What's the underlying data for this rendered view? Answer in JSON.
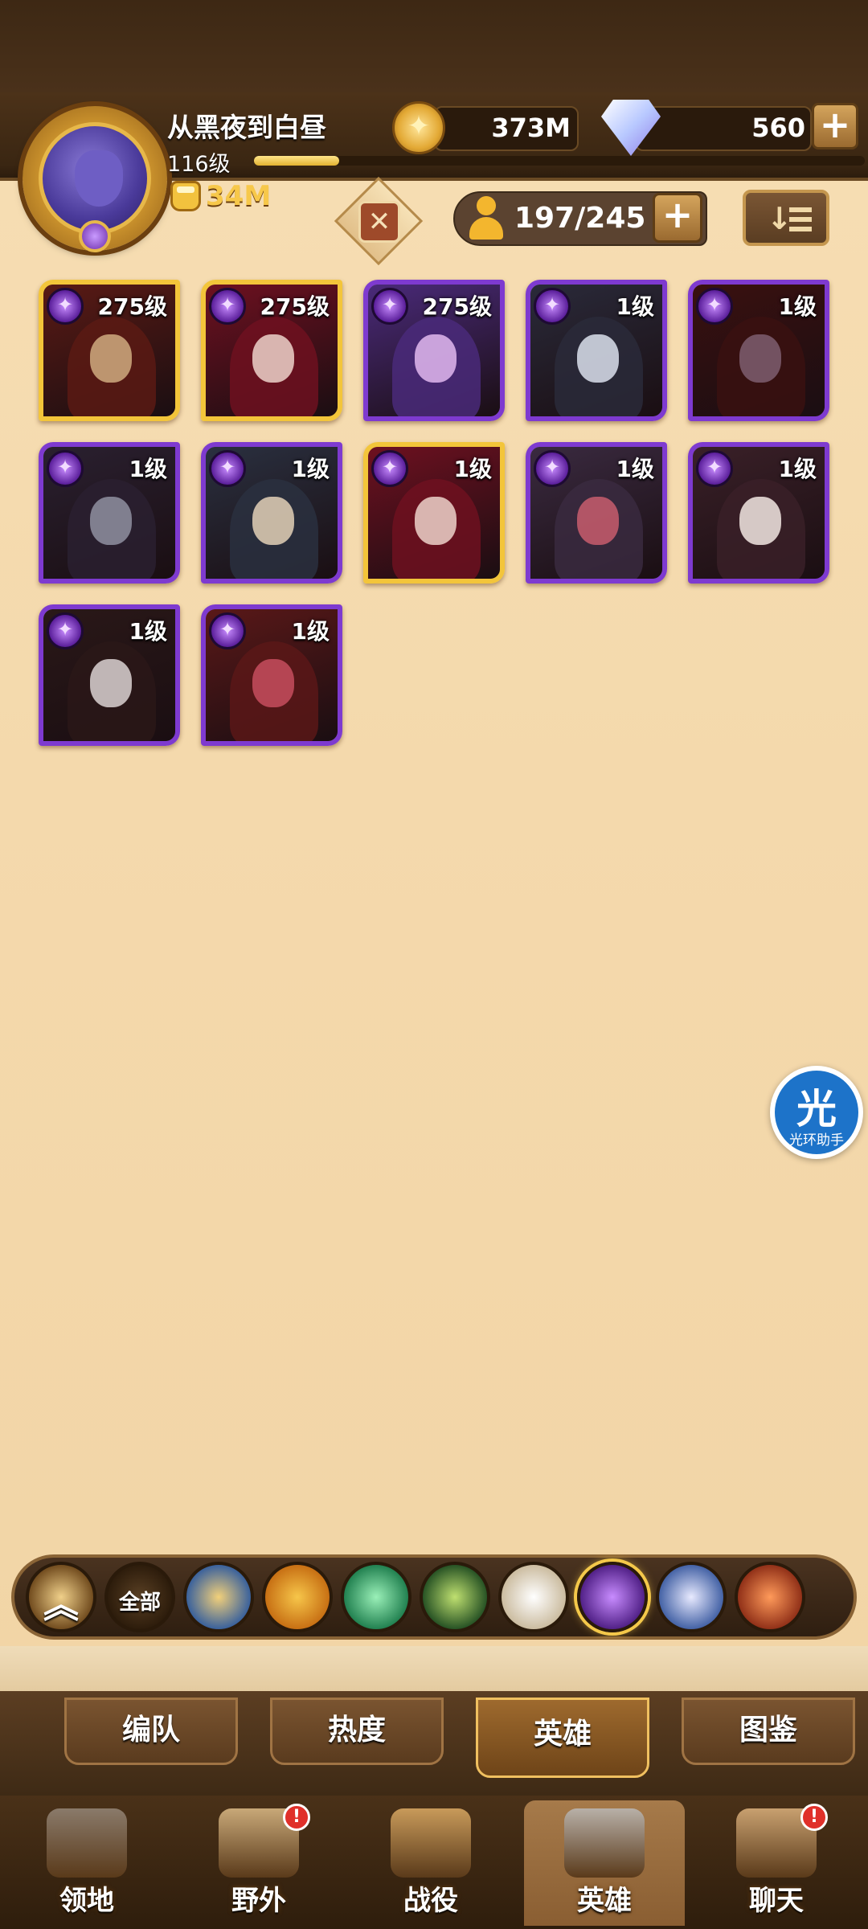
{
  "player": {
    "name": "从黑夜到白昼",
    "level": "116级",
    "power": "34M",
    "xp_progress": 0.14
  },
  "currency": {
    "gold": "373M",
    "gems": "560",
    "plus": "+"
  },
  "toolbar": {
    "hero_count": "197/245",
    "plus": "+"
  },
  "heroes": [
    {
      "level": "275级",
      "frame": "gold",
      "colors": [
        "#5a1a14",
        "#c9a37a"
      ]
    },
    {
      "level": "275级",
      "frame": "gold",
      "colors": [
        "#6e1020",
        "#e6c8c0"
      ]
    },
    {
      "level": "275级",
      "frame": "purple",
      "colors": [
        "#4a2a7a",
        "#d8b0e8"
      ]
    },
    {
      "level": "1级",
      "frame": "purple",
      "colors": [
        "#2a2a3a",
        "#d0d6e2"
      ]
    },
    {
      "level": "1级",
      "frame": "purple",
      "colors": [
        "#3a1010",
        "#7a5a6a"
      ]
    },
    {
      "level": "1级",
      "frame": "purple",
      "colors": [
        "#2a2030",
        "#8a8a9a"
      ]
    },
    {
      "level": "1级",
      "frame": "purple",
      "colors": [
        "#2a3040",
        "#d8c8b0"
      ]
    },
    {
      "level": "1级",
      "frame": "gold",
      "colors": [
        "#6e1020",
        "#e6c8c0"
      ]
    },
    {
      "level": "1级",
      "frame": "purple",
      "colors": [
        "#3a2a40",
        "#c05a6a"
      ]
    },
    {
      "level": "1级",
      "frame": "purple",
      "colors": [
        "#3a2028",
        "#e8dcd8"
      ]
    },
    {
      "level": "1级",
      "frame": "purple",
      "colors": [
        "#2a1818",
        "#d0c8c8"
      ]
    },
    {
      "level": "1级",
      "frame": "purple",
      "colors": [
        "#5a1818",
        "#c04a5a"
      ]
    }
  ],
  "faction_filters": [
    {
      "name": "up-chevron",
      "label": "",
      "colors": [
        "#f0d08a",
        "#6a4418"
      ]
    },
    {
      "name": "all",
      "label": "全部",
      "colors": [
        "#5a4024",
        "#2a1a0a"
      ]
    },
    {
      "name": "lightbearer",
      "label": "",
      "colors": [
        "#f2d07a",
        "#2e5a9e"
      ]
    },
    {
      "name": "mauler",
      "label": "",
      "colors": [
        "#f7c64a",
        "#c46a10"
      ]
    },
    {
      "name": "wilder",
      "label": "",
      "colors": [
        "#9af0b8",
        "#1a7a4a"
      ]
    },
    {
      "name": "graveborn",
      "label": "",
      "colors": [
        "#bfe070",
        "#1e4a20"
      ]
    },
    {
      "name": "celestial",
      "label": "",
      "colors": [
        "#ffffff",
        "#c8b89a"
      ]
    },
    {
      "name": "hypogean",
      "label": "",
      "colors": [
        "#c88cff",
        "#4a1a80"
      ]
    },
    {
      "name": "dimensional",
      "label": "",
      "colors": [
        "#e8eaff",
        "#3a5aa0"
      ]
    },
    {
      "name": "dragon",
      "label": "",
      "colors": [
        "#ff9a5a",
        "#8a2a14"
      ]
    }
  ],
  "selected_faction_index": 7,
  "subtabs": [
    "编队",
    "热度",
    "英雄",
    "图鉴"
  ],
  "active_subtab_index": 2,
  "bottom_nav": [
    {
      "label": "领地",
      "alert": false
    },
    {
      "label": "野外",
      "alert": true
    },
    {
      "label": "战役",
      "alert": false
    },
    {
      "label": "英雄",
      "alert": false
    },
    {
      "label": "聊天",
      "alert": true
    }
  ],
  "active_nav_index": 3,
  "alert_mark": "!",
  "helper": {
    "char": "光",
    "label": "光环助手"
  }
}
